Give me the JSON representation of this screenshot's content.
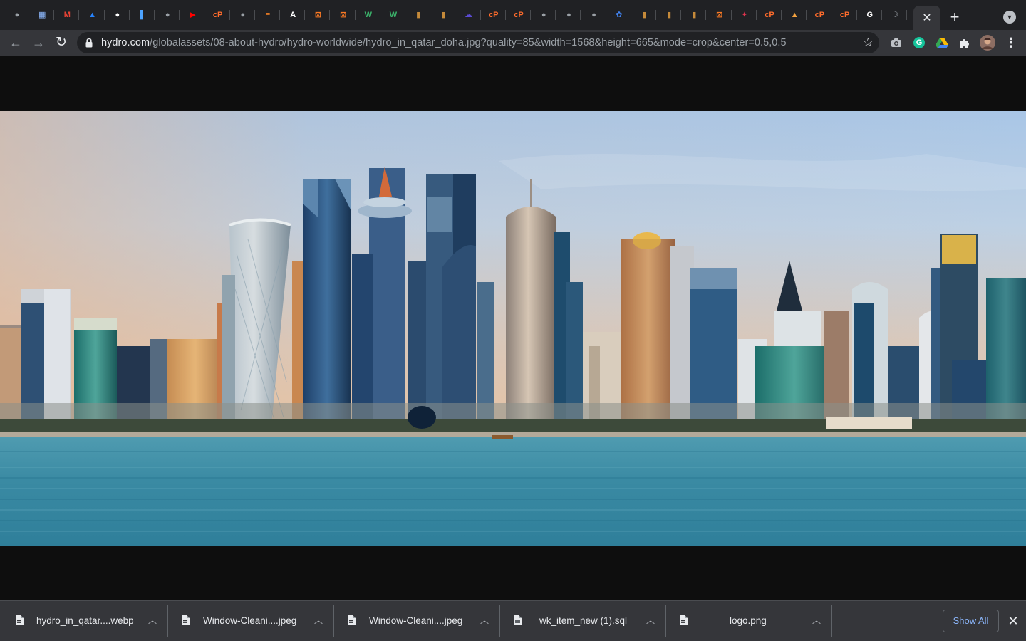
{
  "browser": {
    "active_tab_close": "✕",
    "new_tab": "+",
    "tab_favicons": [
      {
        "icon": "globe-icon",
        "color": "#9aa0a6",
        "glyph": "●"
      },
      {
        "icon": "calendar-icon",
        "color": "#8ab4f8",
        "glyph": "▦"
      },
      {
        "icon": "gmail-icon",
        "color": "#ea4335",
        "glyph": "M"
      },
      {
        "icon": "atlassian-icon",
        "color": "#2684ff",
        "glyph": "▲"
      },
      {
        "icon": "globe-icon",
        "color": "#ffffff",
        "glyph": "●"
      },
      {
        "icon": "bar-icon",
        "color": "#4da3ff",
        "glyph": "▌"
      },
      {
        "icon": "globe-icon",
        "color": "#9aa0a6",
        "glyph": "●"
      },
      {
        "icon": "youtube-icon",
        "color": "#ff0000",
        "glyph": "▶"
      },
      {
        "icon": "cpanel-icon",
        "color": "#ff6c2c",
        "glyph": "cP"
      },
      {
        "icon": "globe-icon",
        "color": "#9aa0a6",
        "glyph": "●"
      },
      {
        "icon": "stackoverflow-icon",
        "color": "#f48024",
        "glyph": "≡"
      },
      {
        "icon": "angular-icon",
        "color": "#ffffff",
        "glyph": "A"
      },
      {
        "icon": "xampp-icon",
        "color": "#fb7a24",
        "glyph": "⊠"
      },
      {
        "icon": "xampp-icon",
        "color": "#fb7a24",
        "glyph": "⊠"
      },
      {
        "icon": "wordpress-icon",
        "color": "#3bb36b",
        "glyph": "W"
      },
      {
        "icon": "wordpress-icon",
        "color": "#3bb36b",
        "glyph": "W"
      },
      {
        "icon": "bookmark-icon",
        "color": "#c58a3a",
        "glyph": "▮"
      },
      {
        "icon": "bookmark-icon",
        "color": "#c58a3a",
        "glyph": "▮"
      },
      {
        "icon": "cloud-icon",
        "color": "#5b4bd5",
        "glyph": "☁"
      },
      {
        "icon": "cpanel-icon",
        "color": "#ff6c2c",
        "glyph": "cP"
      },
      {
        "icon": "cpanel-icon",
        "color": "#ff6c2c",
        "glyph": "cP"
      },
      {
        "icon": "globe-icon",
        "color": "#9aa0a6",
        "glyph": "●"
      },
      {
        "icon": "globe-icon",
        "color": "#9aa0a6",
        "glyph": "●"
      },
      {
        "icon": "globe-icon",
        "color": "#9aa0a6",
        "glyph": "●"
      },
      {
        "icon": "settings-icon",
        "color": "#4285f4",
        "glyph": "✿"
      },
      {
        "icon": "bookmark-icon",
        "color": "#c58a3a",
        "glyph": "▮"
      },
      {
        "icon": "bookmark-icon",
        "color": "#c58a3a",
        "glyph": "▮"
      },
      {
        "icon": "bookmark-icon",
        "color": "#c58a3a",
        "glyph": "▮"
      },
      {
        "icon": "xampp-icon",
        "color": "#fb7a24",
        "glyph": "⊠"
      },
      {
        "icon": "pin-icon",
        "color": "#e2344f",
        "glyph": "✦"
      },
      {
        "icon": "cpanel-icon",
        "color": "#ff6c2c",
        "glyph": "cP"
      },
      {
        "icon": "mountain-icon",
        "color": "#f4a340",
        "glyph": "▲"
      },
      {
        "icon": "cpanel-icon",
        "color": "#ff6c2c",
        "glyph": "cP"
      },
      {
        "icon": "cpanel-icon",
        "color": "#ff6c2c",
        "glyph": "cP"
      },
      {
        "icon": "google-icon",
        "color": "#ffffff",
        "glyph": "G"
      },
      {
        "icon": "moon-icon",
        "color": "#9aa0a6",
        "glyph": "☽"
      }
    ]
  },
  "toolbar": {
    "back": "←",
    "forward": "→",
    "reload": "↻",
    "url_host": "hydro.com",
    "url_path": "/globalassets/08-about-hydro/hydro-worldwide/hydro_in_qatar_doha.jpg?quality=85&width=1568&height=665&mode=crop&center=0.5,0.5",
    "star": "☆",
    "menu": "⋮",
    "grammarly_letter": "G"
  },
  "downloads": {
    "items": [
      {
        "name": "hydro_in_qatar....webp"
      },
      {
        "name": "Window-Cleani....jpeg"
      },
      {
        "name": "Window-Cleani....jpeg"
      },
      {
        "name": "wk_item_new (1).sql"
      },
      {
        "name": "logo.png"
      }
    ],
    "show_all": "Show All",
    "close": "✕"
  },
  "colors": {
    "tabstrip": "#202124",
    "toolbar": "#35363a",
    "viewer_bg": "#0e0e0e",
    "link_blue": "#8ab4f8"
  }
}
